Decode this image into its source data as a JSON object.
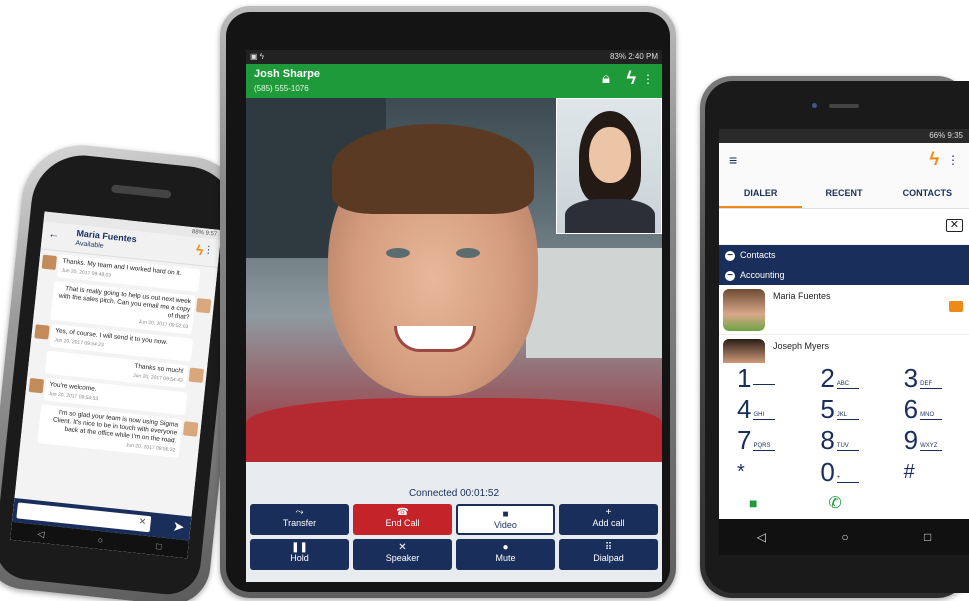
{
  "left_phone": {
    "status": "88% 9:57",
    "contact_name": "Maria Fuentes",
    "contact_status": "Available",
    "messages": [
      {
        "dir": "in",
        "text": "Thanks. My team and I worked hard on it.",
        "time": "Jun 20, 2017 09:48:03"
      },
      {
        "dir": "out",
        "text": "That is really going to help us out next week with the sales pitch. Can you email me a copy of that?",
        "time": "Jun 20, 2017 09:52:03"
      },
      {
        "dir": "in",
        "text": "Yes, of course. I will send it to you now.",
        "time": "Jun 20, 2017 09:54:23"
      },
      {
        "dir": "out",
        "text": "Thanks so much!",
        "time": "Jun 20, 2017 09:54:43"
      },
      {
        "dir": "in",
        "text": "You're welcome.",
        "time": "Jun 20, 2017 09:54:53"
      },
      {
        "dir": "out",
        "text": "I'm so glad your team is now using Sigma Client. It's nice to be in touch with everyone back at the office while I'm on the road.",
        "time": "Jun 20, 2017 09:56:32"
      }
    ]
  },
  "tablet": {
    "status": "83% 2:40 PM",
    "caller_name": "Josh Sharpe",
    "caller_number": "(585) 555-1076",
    "connected": "Connected 00:01:52",
    "buttons": [
      {
        "label": "Transfer",
        "icon": "transfer-icon",
        "glyph": "⤳"
      },
      {
        "label": "End Call",
        "icon": "end-call-icon",
        "glyph": "☎"
      },
      {
        "label": "Video",
        "icon": "video-icon",
        "glyph": "■"
      },
      {
        "label": "Add call",
        "icon": "add-call-icon",
        "glyph": "+"
      },
      {
        "label": "Hold",
        "icon": "hold-icon",
        "glyph": "❚❚"
      },
      {
        "label": "Speaker",
        "icon": "speaker-icon",
        "glyph": "✕"
      },
      {
        "label": "Mute",
        "icon": "mute-icon",
        "glyph": "●"
      },
      {
        "label": "Dialpad",
        "icon": "dialpad-icon",
        "glyph": "⠿"
      }
    ]
  },
  "right_phone": {
    "status": "66% 9:35",
    "tabs": [
      "DIALER",
      "RECENT",
      "CONTACTS"
    ],
    "groups": [
      "Contacts",
      "Accounting"
    ],
    "contacts": [
      "Maria Fuentes",
      "Joseph Myers"
    ],
    "keypad": [
      {
        "d": "1",
        "l": ""
      },
      {
        "d": "2",
        "l": "ABC"
      },
      {
        "d": "3",
        "l": "DEF"
      },
      {
        "d": "4",
        "l": "GHI"
      },
      {
        "d": "5",
        "l": "JKL"
      },
      {
        "d": "6",
        "l": "MNO"
      },
      {
        "d": "7",
        "l": "PQRS"
      },
      {
        "d": "8",
        "l": "TUV"
      },
      {
        "d": "9",
        "l": "WXYZ"
      },
      {
        "d": "*",
        "l": ""
      },
      {
        "d": "0",
        "l": "+"
      },
      {
        "d": "#",
        "l": ""
      }
    ]
  },
  "colors": {
    "navy": "#1a2e5c",
    "green": "#1f9a3a",
    "orange": "#f08a16",
    "red": "#c4232a"
  }
}
